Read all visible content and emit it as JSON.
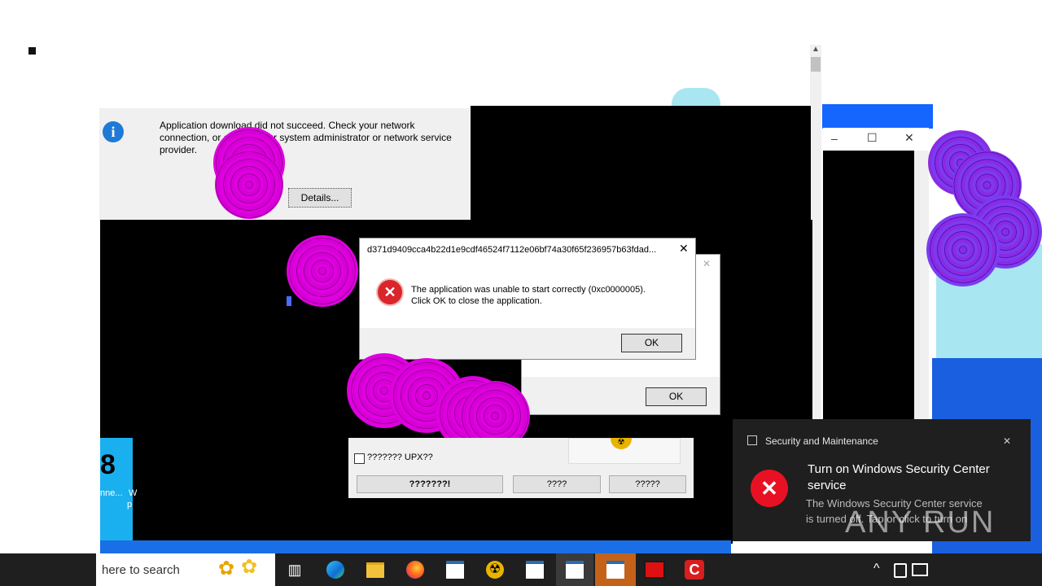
{
  "info_dialog": {
    "message_line1": "Application download did not succeed. Check your network",
    "message_line2": "connection, or contact your system administrator or network service",
    "message_line3": "provider.",
    "overlay_text_a": "network",
    "overlay_text_b": "or network",
    "details_button": "Details..."
  },
  "error_dialog": {
    "title": "d371d9409cca4b22d1e9cdf46524f7112e06bf74a30f65f236957b63fdad...",
    "title_ghost": "71d9409",
    "message_line1": "The application was unable to start correctly (0xc0000005).",
    "message_line2": "Click OK to close the application.",
    "ok_button": "OK",
    "back_ok_button": "OK"
  },
  "upx_dialog": {
    "checkbox_label": "??????? UPX??",
    "button1": "???????!",
    "button2": "????",
    "button3": "?????"
  },
  "window_controls": {
    "minimize": "–",
    "maximize": "☐",
    "close": "✕"
  },
  "left_fragment": {
    "big_char": "8",
    "text1": "nne...",
    "text2": "W",
    "text3": "p"
  },
  "taskbar": {
    "search_placeholder": "here to search",
    "tray_chevron": "^"
  },
  "toast": {
    "app_name": "Security and Maintenance",
    "title_line1": "Turn on Windows Security Center",
    "title_line2": "service",
    "body_line1": "The Windows Security Center service",
    "body_line2": "is turned off. Tap or click to turn on",
    "close": "✕",
    "watermark": "ANY RUN"
  },
  "colors": {
    "magenta": "#e000e0",
    "taskbar": "#1f1f1f",
    "accent": "#0078d7",
    "error_red": "#e81123"
  }
}
